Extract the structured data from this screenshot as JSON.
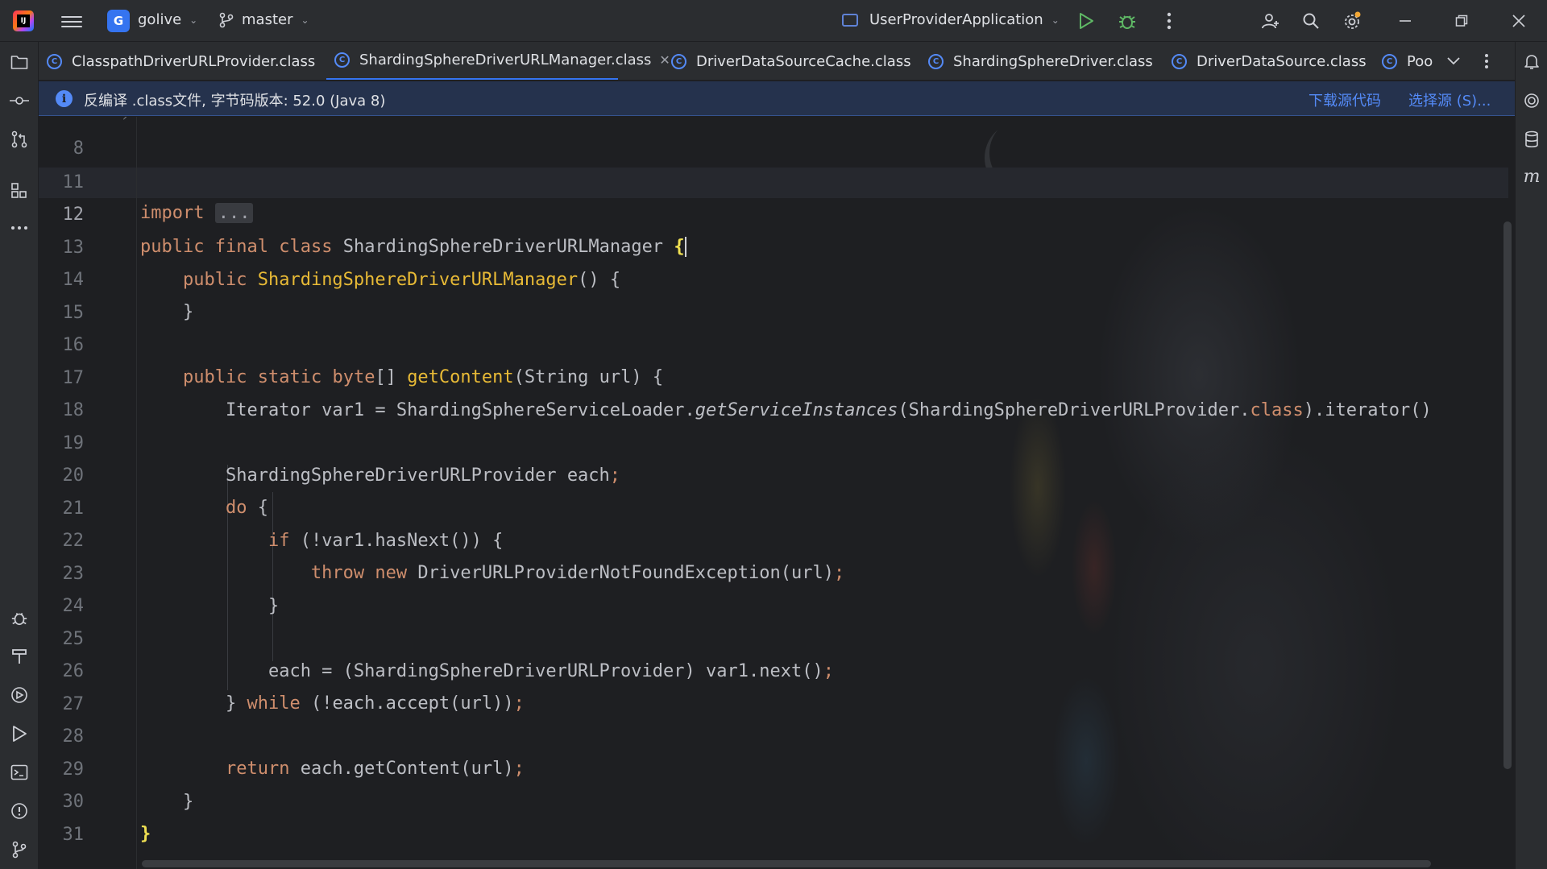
{
  "titlebar": {
    "logo_text": "IJ",
    "project_badge": "G",
    "project_name": "golive",
    "branch_name": "master",
    "run_config": "UserProviderApplication"
  },
  "tabs": [
    {
      "label": "ClasspathDriverURLProvider.class",
      "active": false
    },
    {
      "label": "ShardingSphereDriverURLManager.class",
      "active": true
    },
    {
      "label": "DriverDataSourceCache.class",
      "active": false
    },
    {
      "label": "ShardingSphereDriver.class",
      "active": false
    },
    {
      "label": "DriverDataSource.class",
      "active": false
    },
    {
      "label": "Poo",
      "active": false
    }
  ],
  "tab_icon_letter": "C",
  "banner": {
    "text": "反编译 .class文件, 字节码版本: 52.0 (Java 8)",
    "download_link": "下载源代码",
    "choose_source_link": "选择源 (S)..."
  },
  "editor": {
    "current_line": 12,
    "lines": [
      {
        "n": "8"
      },
      {
        "n": "11"
      },
      {
        "n": "12"
      },
      {
        "n": "13"
      },
      {
        "n": "14"
      },
      {
        "n": "15"
      },
      {
        "n": "16"
      },
      {
        "n": "17"
      },
      {
        "n": "18"
      },
      {
        "n": "19"
      },
      {
        "n": "20"
      },
      {
        "n": "21"
      },
      {
        "n": "22"
      },
      {
        "n": "23"
      },
      {
        "n": "24"
      },
      {
        "n": "25"
      },
      {
        "n": "26"
      },
      {
        "n": "27"
      },
      {
        "n": "28"
      },
      {
        "n": "29"
      },
      {
        "n": "30"
      },
      {
        "n": "31"
      }
    ],
    "tokens": {
      "import": "import",
      "folded": "...",
      "public": "public",
      "final": "final",
      "class_kw": "class",
      "static": "static",
      "byte": "byte",
      "do": "do",
      "if": "if",
      "throw": "throw",
      "new": "new",
      "while": "while",
      "return": "return",
      "class_name": "ShardingSphereDriverURLManager",
      "open_brace": "{",
      "close_brace": "}",
      "ctor_parens": "() {",
      "method_name": "getContent",
      "method_params": "(String url) {",
      "l17_a": "Iterator var1 = ShardingSphereServiceLoader.",
      "l17_b": "getServiceInstances",
      "l17_c": "(ShardingSphereDriverURLProvider.",
      "l17_d": ").iterator()",
      "l19": "ShardingSphereDriverURLProvider each",
      "semi": ";",
      "l21_rest": " (!var1.hasNext()) {",
      "l22_rest": " DriverURLProviderNotFoundException(url)",
      "l25": "each = (ShardingSphereDriverURLProvider) var1.next()",
      "l26_rest": " (!each.accept(url))",
      "l28_rest": " each.getContent(url)",
      "brackets": "[]",
      "brace_space": " {"
    }
  }
}
